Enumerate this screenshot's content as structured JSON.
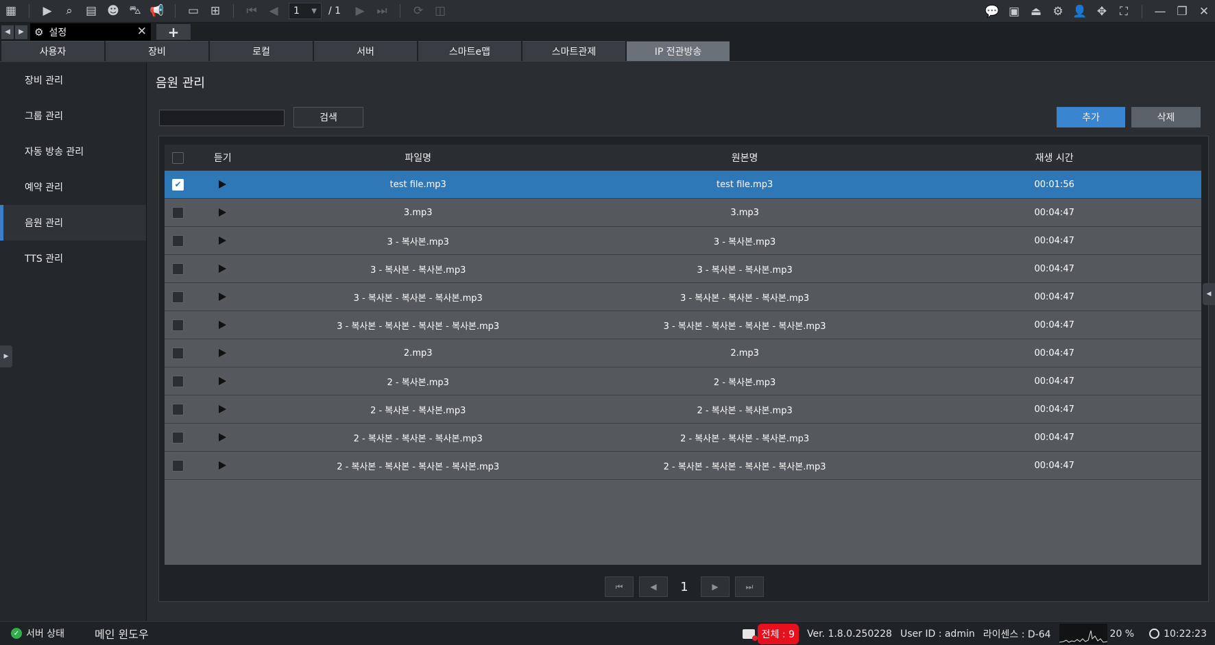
{
  "toolbar": {
    "page_current": "1",
    "page_total": "/ 1"
  },
  "doc_tab": {
    "title": "설정"
  },
  "section_tabs": [
    "사용자",
    "장비",
    "로컬",
    "서버",
    "스마트e맵",
    "스마트관제",
    "IP 전관방송"
  ],
  "active_section_index": 6,
  "sidebar": {
    "items": [
      "장비 관리",
      "그룹 관리",
      "자동 방송 관리",
      "예약 관리",
      "음원 관리",
      "TTS 관리"
    ],
    "active_index": 4
  },
  "main": {
    "title": "음원 관리",
    "search_value": "",
    "search_button": "검색",
    "add_button": "추가",
    "delete_button": "삭제"
  },
  "grid": {
    "headers": {
      "listen": "듣기",
      "filename": "파일명",
      "original": "원본명",
      "duration": "재생 시간"
    },
    "rows": [
      {
        "file": "test file.mp3",
        "orig": "test file.mp3",
        "time": "00:01:56",
        "checked": true
      },
      {
        "file": "3.mp3",
        "orig": "3.mp3",
        "time": "00:04:47",
        "checked": false
      },
      {
        "file": "3 - 복사본.mp3",
        "orig": "3 - 복사본.mp3",
        "time": "00:04:47",
        "checked": false
      },
      {
        "file": "3 - 복사본 - 복사본.mp3",
        "orig": "3 - 복사본 - 복사본.mp3",
        "time": "00:04:47",
        "checked": false
      },
      {
        "file": "3 - 복사본 - 복사본 - 복사본.mp3",
        "orig": "3 - 복사본 - 복사본 - 복사본.mp3",
        "time": "00:04:47",
        "checked": false
      },
      {
        "file": "3 - 복사본 - 복사본 - 복사본 - 복사본.mp3",
        "orig": "3 - 복사본 - 복사본 - 복사본 - 복사본.mp3",
        "time": "00:04:47",
        "checked": false
      },
      {
        "file": "2.mp3",
        "orig": "2.mp3",
        "time": "00:04:47",
        "checked": false
      },
      {
        "file": "2 - 복사본.mp3",
        "orig": "2 - 복사본.mp3",
        "time": "00:04:47",
        "checked": false
      },
      {
        "file": "2 - 복사본 - 복사본.mp3",
        "orig": "2 - 복사본 - 복사본.mp3",
        "time": "00:04:47",
        "checked": false
      },
      {
        "file": "2 - 복사본 - 복사본 - 복사본.mp3",
        "orig": "2 - 복사본 - 복사본 - 복사본.mp3",
        "time": "00:04:47",
        "checked": false
      },
      {
        "file": "2 - 복사본 - 복사본 - 복사본 - 복사본.mp3",
        "orig": "2 - 복사본 - 복사본 - 복사본 - 복사본.mp3",
        "time": "00:04:47",
        "checked": false
      }
    ]
  },
  "pager": {
    "current": "1"
  },
  "status": {
    "server_status": "서버 상태",
    "main_window": "메인 윈도우",
    "total_badge": "전체 : 9",
    "version": "Ver. 1.8.0.250228",
    "user_id": "User ID : admin",
    "license": "라이센스 : D-64",
    "cpu": "20 %",
    "time": "10:22:23"
  },
  "colors": {
    "accent": "#3a85d0",
    "selected_row": "#2f78b8",
    "alert": "#e8101c",
    "ok": "#2fae4a"
  }
}
